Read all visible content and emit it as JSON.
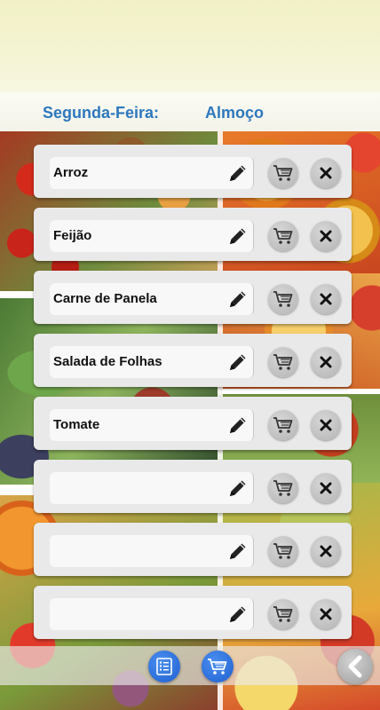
{
  "header": {
    "day": "Segunda-Feira:",
    "meal": "Almoço"
  },
  "items": [
    {
      "name": "Arroz"
    },
    {
      "name": "Feijão"
    },
    {
      "name": "Carne de Panela"
    },
    {
      "name": "Salada de Folhas"
    },
    {
      "name": "Tomate"
    },
    {
      "name": ""
    },
    {
      "name": ""
    },
    {
      "name": ""
    }
  ],
  "icons": {
    "edit": "pencil-icon",
    "cart": "cart-icon",
    "delete": "close-icon",
    "list": "list-icon",
    "shopping": "cart-icon",
    "back": "chevron-left-icon"
  },
  "colors": {
    "header_text": "#2e78bd",
    "action_blue": "#2a6fe0"
  }
}
